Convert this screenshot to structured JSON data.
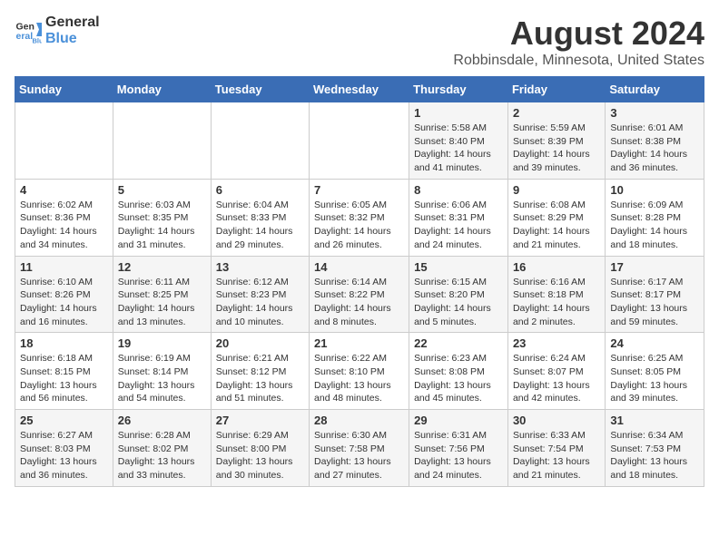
{
  "header": {
    "logo_line1": "General",
    "logo_line2": "Blue",
    "title": "August 2024",
    "subtitle": "Robbinsdale, Minnesota, United States"
  },
  "columns": [
    "Sunday",
    "Monday",
    "Tuesday",
    "Wednesday",
    "Thursday",
    "Friday",
    "Saturday"
  ],
  "weeks": [
    [
      {
        "day": "",
        "info": ""
      },
      {
        "day": "",
        "info": ""
      },
      {
        "day": "",
        "info": ""
      },
      {
        "day": "",
        "info": ""
      },
      {
        "day": "1",
        "info": "Sunrise: 5:58 AM\nSunset: 8:40 PM\nDaylight: 14 hours and 41 minutes."
      },
      {
        "day": "2",
        "info": "Sunrise: 5:59 AM\nSunset: 8:39 PM\nDaylight: 14 hours and 39 minutes."
      },
      {
        "day": "3",
        "info": "Sunrise: 6:01 AM\nSunset: 8:38 PM\nDaylight: 14 hours and 36 minutes."
      }
    ],
    [
      {
        "day": "4",
        "info": "Sunrise: 6:02 AM\nSunset: 8:36 PM\nDaylight: 14 hours and 34 minutes."
      },
      {
        "day": "5",
        "info": "Sunrise: 6:03 AM\nSunset: 8:35 PM\nDaylight: 14 hours and 31 minutes."
      },
      {
        "day": "6",
        "info": "Sunrise: 6:04 AM\nSunset: 8:33 PM\nDaylight: 14 hours and 29 minutes."
      },
      {
        "day": "7",
        "info": "Sunrise: 6:05 AM\nSunset: 8:32 PM\nDaylight: 14 hours and 26 minutes."
      },
      {
        "day": "8",
        "info": "Sunrise: 6:06 AM\nSunset: 8:31 PM\nDaylight: 14 hours and 24 minutes."
      },
      {
        "day": "9",
        "info": "Sunrise: 6:08 AM\nSunset: 8:29 PM\nDaylight: 14 hours and 21 minutes."
      },
      {
        "day": "10",
        "info": "Sunrise: 6:09 AM\nSunset: 8:28 PM\nDaylight: 14 hours and 18 minutes."
      }
    ],
    [
      {
        "day": "11",
        "info": "Sunrise: 6:10 AM\nSunset: 8:26 PM\nDaylight: 14 hours and 16 minutes."
      },
      {
        "day": "12",
        "info": "Sunrise: 6:11 AM\nSunset: 8:25 PM\nDaylight: 14 hours and 13 minutes."
      },
      {
        "day": "13",
        "info": "Sunrise: 6:12 AM\nSunset: 8:23 PM\nDaylight: 14 hours and 10 minutes."
      },
      {
        "day": "14",
        "info": "Sunrise: 6:14 AM\nSunset: 8:22 PM\nDaylight: 14 hours and 8 minutes."
      },
      {
        "day": "15",
        "info": "Sunrise: 6:15 AM\nSunset: 8:20 PM\nDaylight: 14 hours and 5 minutes."
      },
      {
        "day": "16",
        "info": "Sunrise: 6:16 AM\nSunset: 8:18 PM\nDaylight: 14 hours and 2 minutes."
      },
      {
        "day": "17",
        "info": "Sunrise: 6:17 AM\nSunset: 8:17 PM\nDaylight: 13 hours and 59 minutes."
      }
    ],
    [
      {
        "day": "18",
        "info": "Sunrise: 6:18 AM\nSunset: 8:15 PM\nDaylight: 13 hours and 56 minutes."
      },
      {
        "day": "19",
        "info": "Sunrise: 6:19 AM\nSunset: 8:14 PM\nDaylight: 13 hours and 54 minutes."
      },
      {
        "day": "20",
        "info": "Sunrise: 6:21 AM\nSunset: 8:12 PM\nDaylight: 13 hours and 51 minutes."
      },
      {
        "day": "21",
        "info": "Sunrise: 6:22 AM\nSunset: 8:10 PM\nDaylight: 13 hours and 48 minutes."
      },
      {
        "day": "22",
        "info": "Sunrise: 6:23 AM\nSunset: 8:08 PM\nDaylight: 13 hours and 45 minutes."
      },
      {
        "day": "23",
        "info": "Sunrise: 6:24 AM\nSunset: 8:07 PM\nDaylight: 13 hours and 42 minutes."
      },
      {
        "day": "24",
        "info": "Sunrise: 6:25 AM\nSunset: 8:05 PM\nDaylight: 13 hours and 39 minutes."
      }
    ],
    [
      {
        "day": "25",
        "info": "Sunrise: 6:27 AM\nSunset: 8:03 PM\nDaylight: 13 hours and 36 minutes."
      },
      {
        "day": "26",
        "info": "Sunrise: 6:28 AM\nSunset: 8:02 PM\nDaylight: 13 hours and 33 minutes."
      },
      {
        "day": "27",
        "info": "Sunrise: 6:29 AM\nSunset: 8:00 PM\nDaylight: 13 hours and 30 minutes."
      },
      {
        "day": "28",
        "info": "Sunrise: 6:30 AM\nSunset: 7:58 PM\nDaylight: 13 hours and 27 minutes."
      },
      {
        "day": "29",
        "info": "Sunrise: 6:31 AM\nSunset: 7:56 PM\nDaylight: 13 hours and 24 minutes."
      },
      {
        "day": "30",
        "info": "Sunrise: 6:33 AM\nSunset: 7:54 PM\nDaylight: 13 hours and 21 minutes."
      },
      {
        "day": "31",
        "info": "Sunrise: 6:34 AM\nSunset: 7:53 PM\nDaylight: 13 hours and 18 minutes."
      }
    ]
  ]
}
